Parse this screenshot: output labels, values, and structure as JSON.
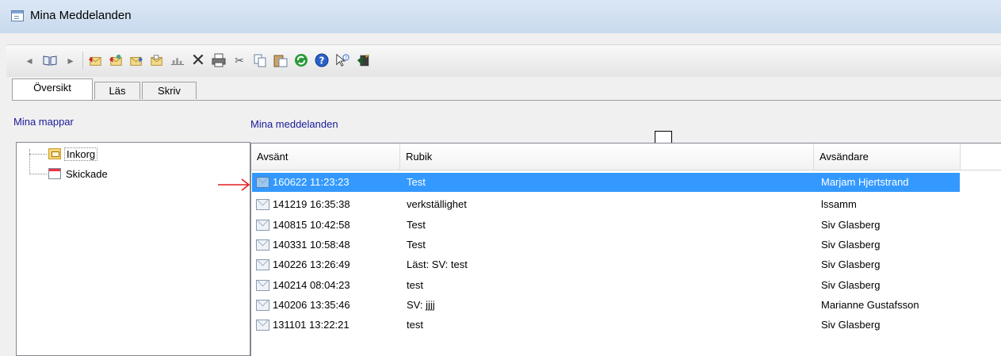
{
  "window": {
    "title": "Mina Meddelanden"
  },
  "toolbar": {
    "buttons": [
      {
        "name": "back-arrow-icon",
        "glyph": "◂"
      },
      {
        "name": "book-icon",
        "glyph": "📖"
      },
      {
        "name": "forward-arrow-icon",
        "glyph": "▸"
      },
      {
        "name": "reply-icon",
        "glyph": "✉"
      },
      {
        "name": "reply-all-icon",
        "glyph": "✉"
      },
      {
        "name": "forward-mail-icon",
        "glyph": "✉"
      },
      {
        "name": "move-mail-icon",
        "glyph": "✉"
      },
      {
        "name": "chart-icon",
        "glyph": "▥"
      },
      {
        "name": "delete-icon",
        "glyph": "✕"
      },
      {
        "name": "print-icon",
        "glyph": "🖶"
      },
      {
        "name": "cut-icon",
        "glyph": "✂"
      },
      {
        "name": "copy-icon",
        "glyph": "⧉"
      },
      {
        "name": "paste-icon",
        "glyph": "📋"
      },
      {
        "name": "refresh-icon",
        "glyph": "↻"
      },
      {
        "name": "help-icon",
        "glyph": "?"
      },
      {
        "name": "whats-this-icon",
        "glyph": "↖"
      },
      {
        "name": "exit-icon",
        "glyph": "🚪"
      }
    ]
  },
  "tabs": [
    {
      "label": "Översikt",
      "active": true
    },
    {
      "label": "Läs",
      "active": false
    },
    {
      "label": "Skriv",
      "active": false
    }
  ],
  "sidebar": {
    "heading": "Mina mappar",
    "folders": [
      {
        "label": "Inkorg",
        "icon": "inbox-folder-icon"
      },
      {
        "label": "Skickade",
        "icon": "sent-folder-icon"
      }
    ]
  },
  "main": {
    "heading": "Mina meddelanden",
    "columns": [
      "Avsänt",
      "Rubik",
      "Avsändare"
    ],
    "messages": [
      {
        "sent": "160622 11:23:23",
        "subject": "Test",
        "sender": "Marjam Hjertstrand",
        "selected": true
      },
      {
        "sent": "141219 16:35:38",
        "subject": "verkställighet",
        "sender": "lssamm",
        "selected": false
      },
      {
        "sent": "140815 10:42:58",
        "subject": "Test",
        "sender": "Siv Glasberg",
        "selected": false
      },
      {
        "sent": "140331 10:58:48",
        "subject": "Test",
        "sender": "Siv Glasberg",
        "selected": false
      },
      {
        "sent": "140226 13:26:49",
        "subject": "Läst: SV: test",
        "sender": "Siv Glasberg",
        "selected": false
      },
      {
        "sent": "140214 08:04:23",
        "subject": "test",
        "sender": "Siv Glasberg",
        "selected": false
      },
      {
        "sent": "140206 13:35:46",
        "subject": "SV: jjjj",
        "sender": "Marianne Gustafsson",
        "selected": false
      },
      {
        "sent": "131101 13:22:21",
        "subject": "test",
        "sender": "Siv Glasberg",
        "selected": false
      }
    ]
  },
  "colors": {
    "selection": "#3399ff",
    "heading": "#1b1b9a",
    "annotation_arrow": "#e02020"
  }
}
